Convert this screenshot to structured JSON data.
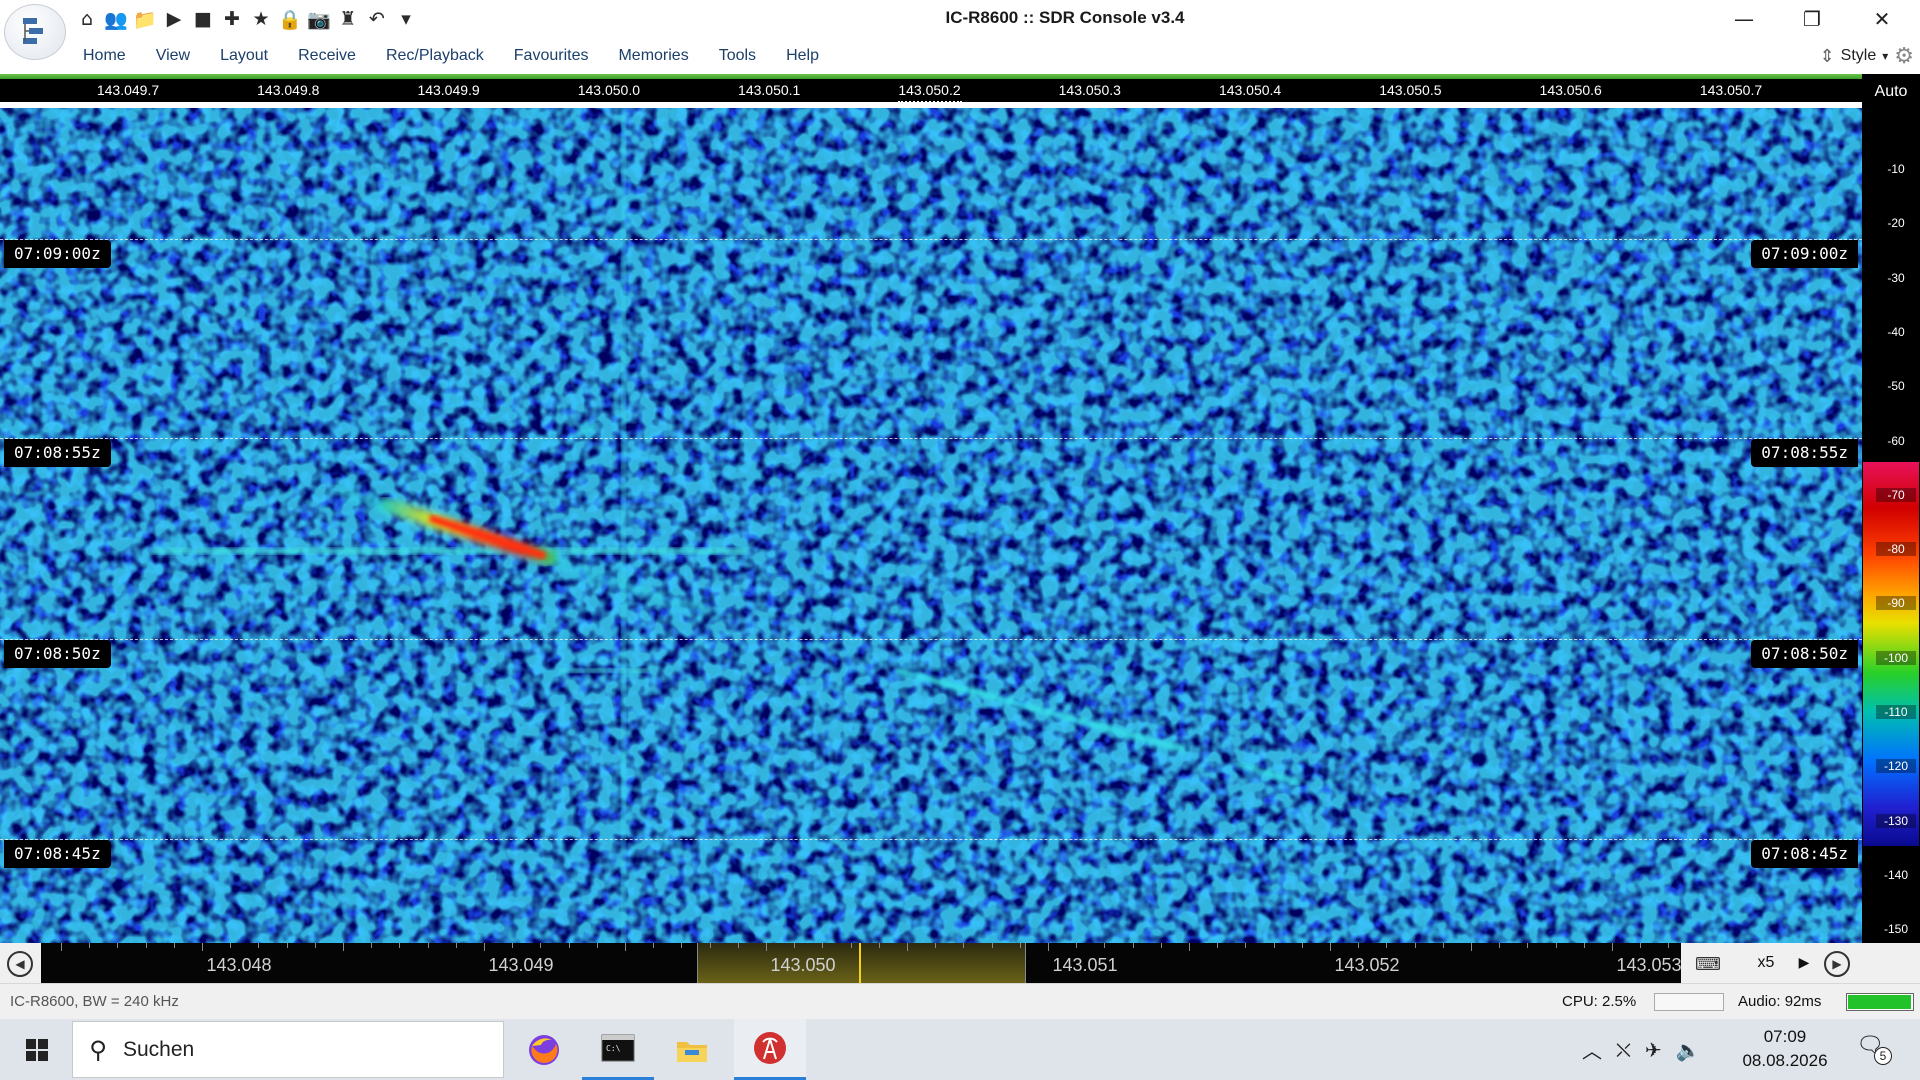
{
  "window": {
    "title": "IC-R8600 :: SDR Console v3.4",
    "minimize_icon": "minimize-icon",
    "restore_icon": "restore-icon",
    "close_icon": "close-icon"
  },
  "quick_access": [
    {
      "icon": "home-icon",
      "glyph": "⌂"
    },
    {
      "icon": "users-icon",
      "glyph": "👥"
    },
    {
      "icon": "folder-icon",
      "glyph": "📁"
    },
    {
      "icon": "play-icon",
      "glyph": "▶"
    },
    {
      "icon": "stop-icon",
      "glyph": "■"
    },
    {
      "icon": "add-icon",
      "glyph": "✚"
    },
    {
      "icon": "star-icon",
      "glyph": "★"
    },
    {
      "icon": "lock-icon",
      "glyph": "🔒"
    },
    {
      "icon": "camera-icon",
      "glyph": "📷"
    },
    {
      "icon": "beacon-icon",
      "glyph": "♜"
    },
    {
      "icon": "undo-icon",
      "glyph": "↶"
    },
    {
      "icon": "customize-dropdown-icon",
      "glyph": "▾"
    }
  ],
  "menu": [
    "Home",
    "View",
    "Layout",
    "Receive",
    "Rec/Playback",
    "Favourites",
    "Memories",
    "Tools",
    "Help"
  ],
  "style_menu": {
    "label": "Style",
    "icon": "style-icon",
    "settings_icon": "gear-icon"
  },
  "frequency_ruler": [
    "143.049.7",
    "143.049.8",
    "143.049.9",
    "143.050.0",
    "143.050.1",
    "143.050.2",
    "143.050.3",
    "143.050.4",
    "143.050.5",
    "143.050.6",
    "143.050.7"
  ],
  "timestamps": [
    "07:09:00z",
    "07:08:55z",
    "07:08:50z",
    "07:08:45z"
  ],
  "db_scale": {
    "auto_label": "Auto",
    "ticks": [
      "-10",
      "-20",
      "-30",
      "-40",
      "-50",
      "-60",
      "-70",
      "-80",
      "-90",
      "-100",
      "-110",
      "-120",
      "-130",
      "-140",
      "-150"
    ],
    "palette": [
      "#e8125a",
      "#d00000",
      "#ff4000",
      "#ffa000",
      "#e8e000",
      "#28d028",
      "#00c0b0",
      "#0070ff",
      "#2020d0",
      "#0a0a90"
    ]
  },
  "spectrum_bar": {
    "labels": [
      "143.048",
      "143.049",
      "143.050",
      "143.051",
      "143.052",
      "143.053"
    ],
    "zoom": "x5",
    "highlight_color": "#f2d21a"
  },
  "status": {
    "radio_info": "IC-R8600, BW = 240 kHz",
    "cpu": "CPU: 2.5%",
    "audio": "Audio: 92ms",
    "audio_level_fraction": 0.95
  },
  "taskbar": {
    "search_placeholder": "Suchen",
    "apps": [
      {
        "name": "firefox",
        "icon": "firefox-icon"
      },
      {
        "name": "terminal",
        "icon": "terminal-icon"
      },
      {
        "name": "file-explorer",
        "icon": "folder-icon"
      },
      {
        "name": "sdr-console",
        "icon": "sdr-console-icon"
      }
    ],
    "time": "07:09",
    "date": "08.08.2026",
    "notifications": "5"
  }
}
